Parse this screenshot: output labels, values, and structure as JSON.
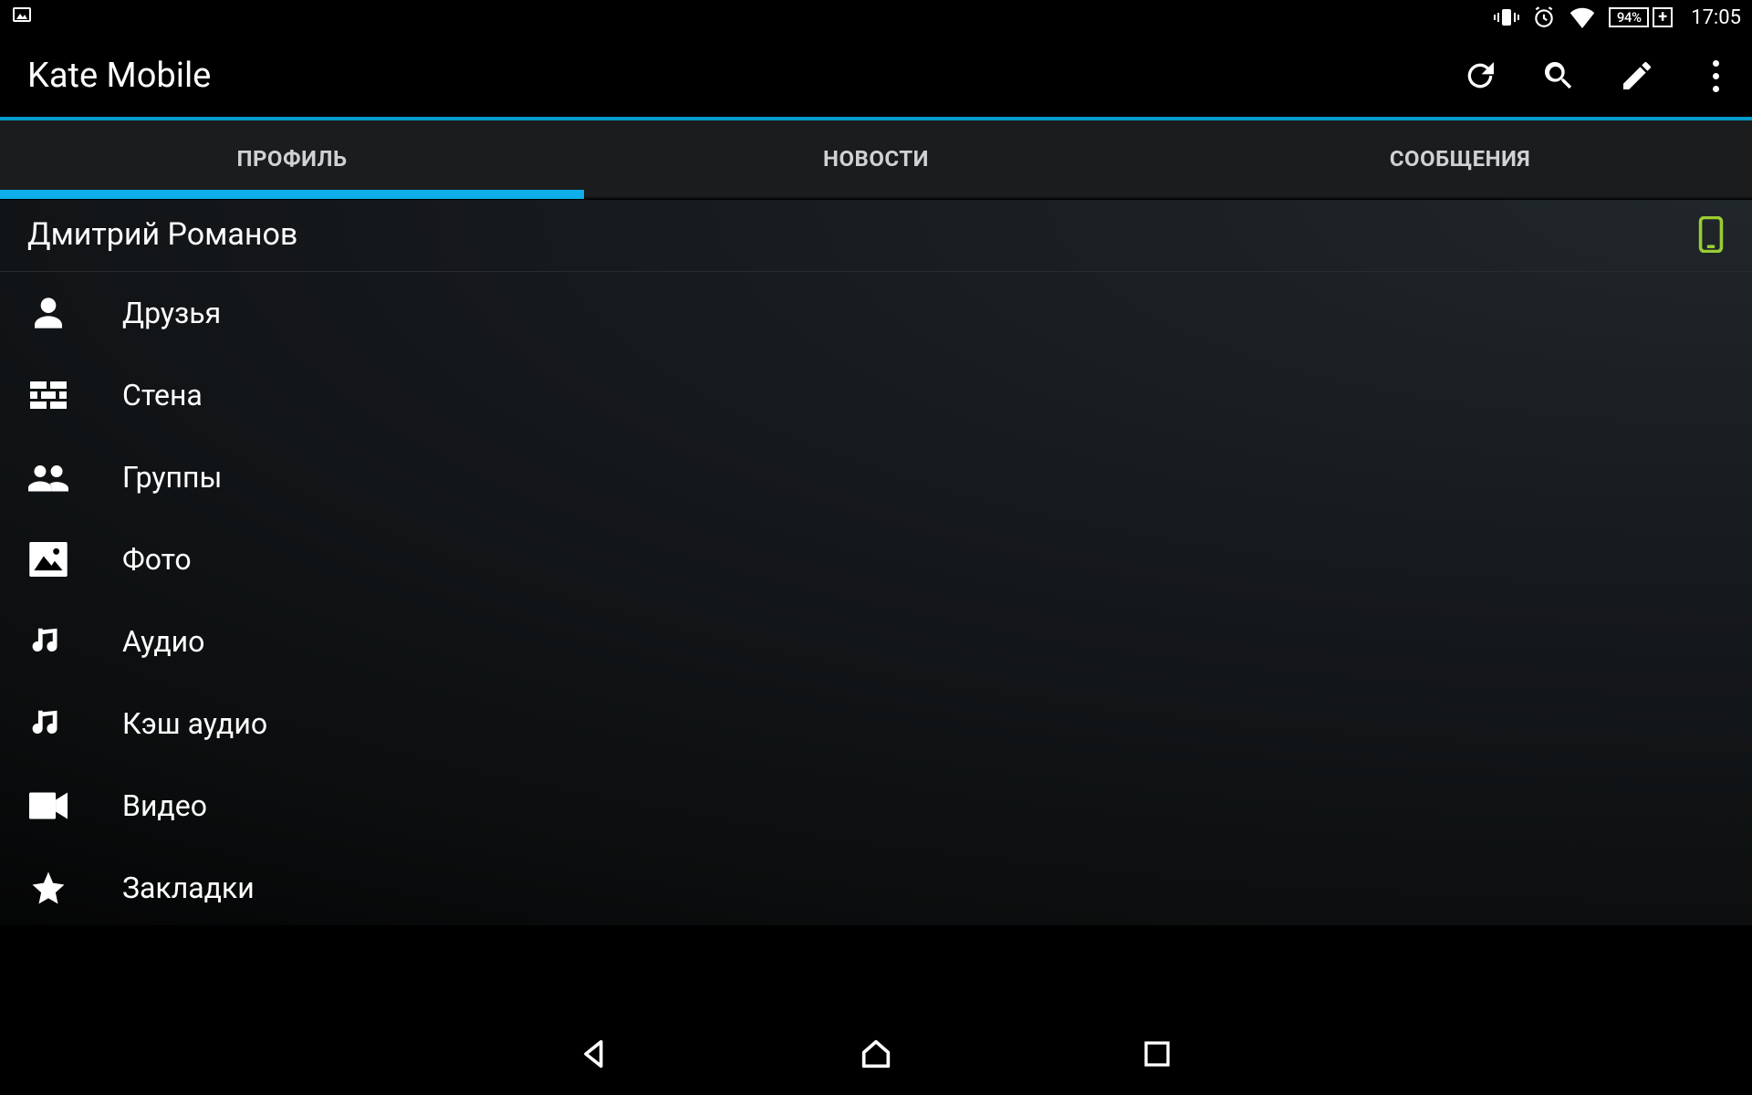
{
  "status_bar": {
    "battery_text": "94%",
    "clock": "17:05"
  },
  "app": {
    "title": "Kate Mobile"
  },
  "tabs": [
    {
      "label": "ПРОФИЛЬ",
      "active": true
    },
    {
      "label": "НОВОСТИ",
      "active": false
    },
    {
      "label": "СООБЩЕНИЯ",
      "active": false
    }
  ],
  "profile": {
    "name": "Дмитрий Романов"
  },
  "menu": [
    {
      "icon": "person",
      "label": "Друзья"
    },
    {
      "icon": "wall",
      "label": "Стена"
    },
    {
      "icon": "groups",
      "label": "Группы"
    },
    {
      "icon": "photo",
      "label": "Фото"
    },
    {
      "icon": "audio",
      "label": "Аудио"
    },
    {
      "icon": "audio",
      "label": "Кэш аудио"
    },
    {
      "icon": "video",
      "label": "Видео"
    },
    {
      "icon": "star",
      "label": "Закладки"
    }
  ]
}
